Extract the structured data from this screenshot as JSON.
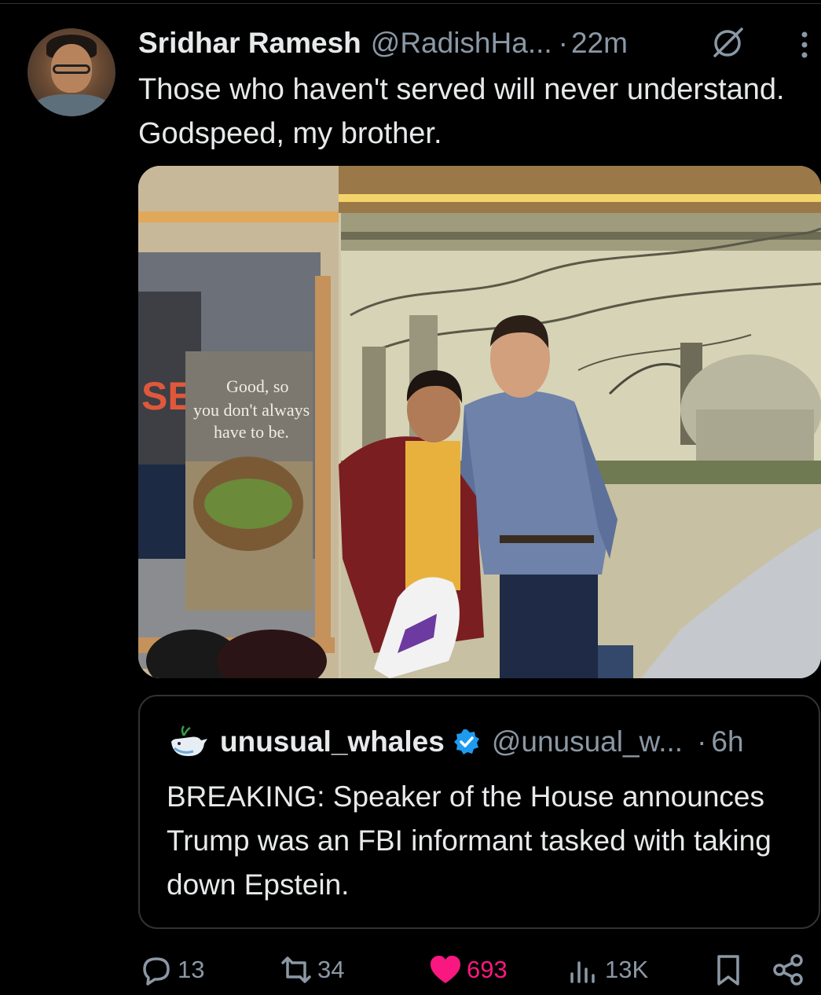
{
  "tweet": {
    "display_name": "Sridhar Ramesh",
    "handle": "@RadishHa...",
    "separator": "·",
    "time": "22m",
    "text": "Those who haven't served will never understand. Godspeed, my brother."
  },
  "photo": {
    "poster_text_line1": "Good, so",
    "poster_text_line2": "you don't always",
    "poster_text_line3": "have to be."
  },
  "quoted_tweet": {
    "display_name": "unusual_whales",
    "handle": "@unusual_w...",
    "separator": "·",
    "time": "6h",
    "text": "BREAKING: Speaker of the House announces Trump was an FBI informant tasked with taking down Epstein."
  },
  "actions": {
    "replies": "13",
    "reposts": "34",
    "likes": "693",
    "views": "13K"
  },
  "colors": {
    "like_active": "#f91880",
    "verified": "#1d9bf0",
    "secondary_text": "#8b98a5"
  },
  "icons": [
    "mute-icon",
    "more-icon",
    "whale-icon",
    "verified-icon",
    "reply-icon",
    "repost-icon",
    "like-icon",
    "views-icon",
    "bookmark-icon",
    "share-icon"
  ]
}
